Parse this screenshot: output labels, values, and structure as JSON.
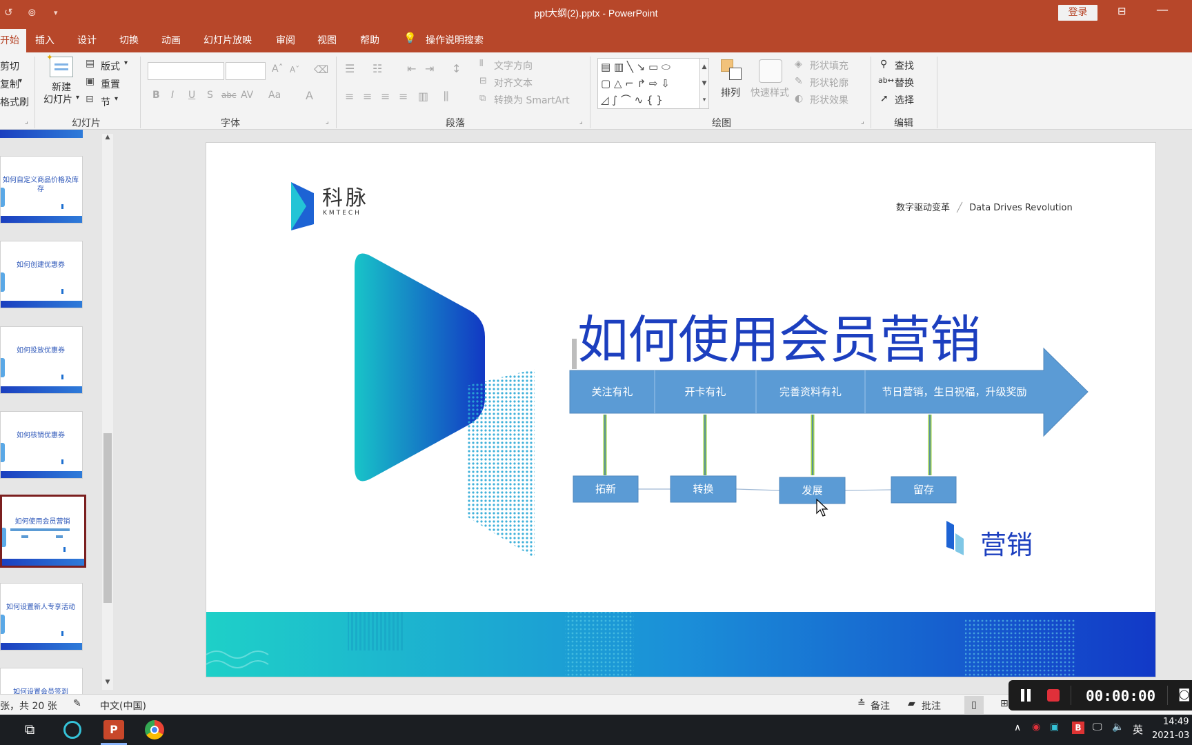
{
  "window": {
    "title": "ppt大纲(2).pptx  -  PowerPoint",
    "login": "登录"
  },
  "tabs": [
    "开始",
    "插入",
    "设计",
    "切换",
    "动画",
    "幻灯片放映",
    "审阅",
    "视图",
    "帮助",
    "操作说明搜索"
  ],
  "ribbon": {
    "clipboard": {
      "cut": "剪切",
      "copy": "复制",
      "format_painter": "格式刷"
    },
    "slides": {
      "new_slide": "新建",
      "new_slide2": "幻灯片",
      "layout": "版式",
      "reset": "重置",
      "section": "节",
      "group": "幻灯片"
    },
    "font": {
      "group": "字体",
      "bold": "B",
      "italic": "I",
      "underline": "U",
      "shadow": "S",
      "strike": "abc",
      "spacing": "AV",
      "case": "Aa",
      "color": "A"
    },
    "paragraph": {
      "group": "段落",
      "text_direction": "文字方向",
      "align_text": "对齐文本",
      "smartart": "转换为 SmartArt"
    },
    "drawing": {
      "group": "绘图",
      "arrange": "排列",
      "quick_styles": "快速样式",
      "shape_fill": "形状填充",
      "shape_outline": "形状轮廓",
      "shape_effects": "形状效果"
    },
    "editing": {
      "group": "编辑",
      "find": "查找",
      "replace": "替换",
      "select": "选择"
    }
  },
  "thumbnails": [
    {
      "title": "如何自定义商品价格及库存"
    },
    {
      "title": "如何创建优惠券"
    },
    {
      "title": "如何投放优惠券"
    },
    {
      "title": "如何核销优惠券"
    },
    {
      "title": "如何使用会员营销"
    },
    {
      "title": "如何设置新人专享活动"
    },
    {
      "title": "如何设置会员签到"
    }
  ],
  "slide": {
    "brand_cn": "科脉",
    "brand_en": "KMTECH",
    "tagline_cn": "数字驱动变革",
    "tagline_en": "Data Drives Revolution",
    "title": "如何使用会员营销",
    "arrow_segments": [
      "关注有礼",
      "开卡有礼",
      "完善资料有礼",
      "节日营销，生日祝福，升级奖励"
    ],
    "stages": [
      "拓新",
      "转换",
      "发展",
      "留存"
    ],
    "corner_label": "营销"
  },
  "status": {
    "slide_count": "张，共 20 张",
    "language": "中文(中国)",
    "notes": "备注",
    "comments": "批注"
  },
  "recorder": {
    "time": "00:00:00"
  },
  "taskbar": {
    "ime": "英",
    "time": "14:49",
    "date": "2021-03"
  },
  "colors": {
    "accent": "#b7472a",
    "slide_blue": "#1c3fbf",
    "arrow_blue": "#5b9bd5"
  }
}
